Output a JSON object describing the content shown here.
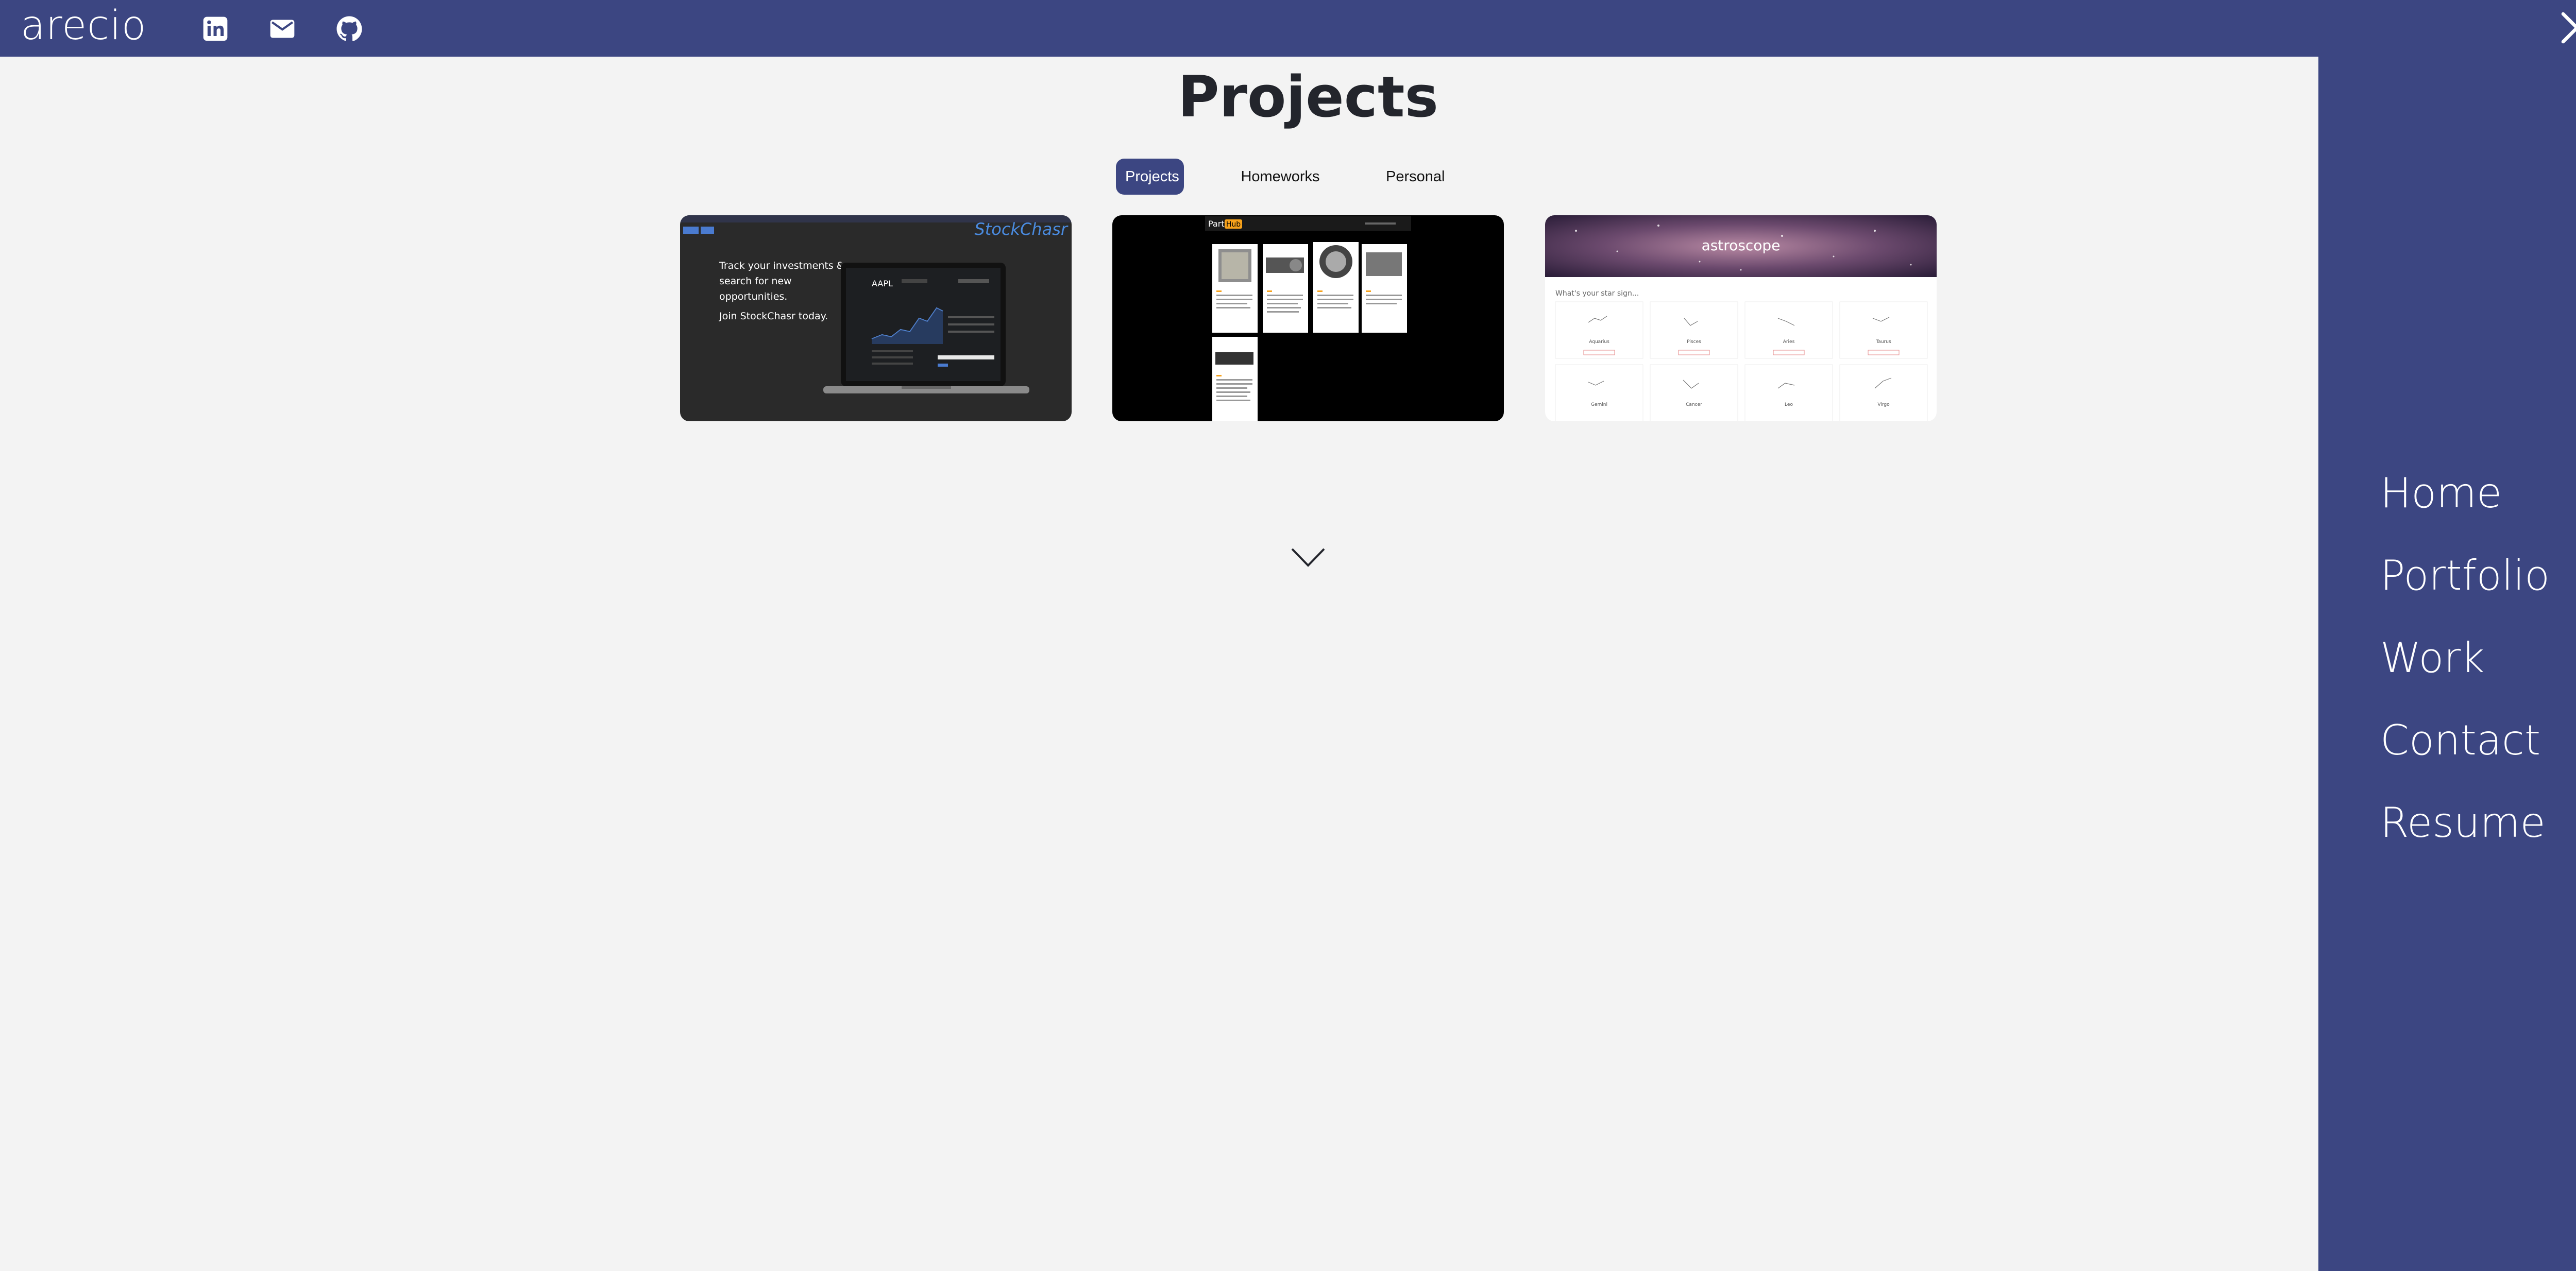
{
  "header": {
    "logo": "arecio",
    "social": [
      {
        "icon": "linkedin-icon"
      },
      {
        "icon": "mail-icon"
      },
      {
        "icon": "github-icon"
      }
    ],
    "close_icon": "close-icon"
  },
  "main": {
    "title": "Projects",
    "tabs": [
      {
        "label": "Projects",
        "active": true
      },
      {
        "label": "Homeworks",
        "active": false
      },
      {
        "label": "Personal",
        "active": false
      }
    ],
    "cards": [
      {
        "brand": "StockChasr",
        "tagline_1": "Track your investments &",
        "tagline_2": "search for new",
        "tagline_3": "opportunities.",
        "tagline_4": "Join StockChasr today.",
        "ticker": "AAPL"
      },
      {
        "brand_a": "Part",
        "brand_b": "Hub"
      },
      {
        "brand": "astroscope",
        "prompt": "What's your star sign...",
        "signs": [
          "Aquarius",
          "Pisces",
          "Aries",
          "Taurus",
          "Gemini",
          "Cancer",
          "Leo",
          "Virgo"
        ]
      }
    ],
    "scroll_icon": "chevron-down-icon"
  },
  "menu": {
    "items": [
      "Home",
      "Portfolio",
      "Work",
      "Contact",
      "Resume"
    ]
  },
  "colors": {
    "brand": "#3c4682",
    "background": "#f3f3f3",
    "text": "#23252c",
    "accent_orange": "#f7a21b"
  }
}
